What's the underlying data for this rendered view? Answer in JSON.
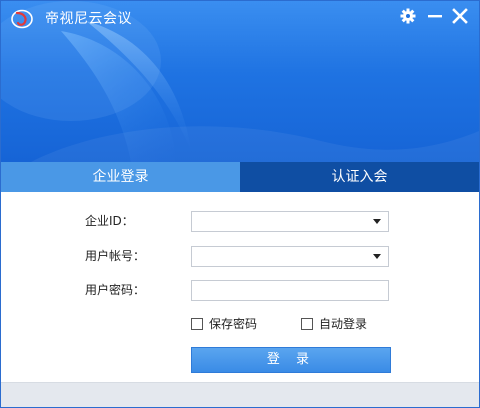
{
  "window": {
    "title": "帝视尼云会议"
  },
  "tabs": [
    {
      "label": "企业登录",
      "active": true
    },
    {
      "label": "认证入会",
      "active": false
    }
  ],
  "form": {
    "enterprise_id_label": "企业ID：",
    "enterprise_id_value": "",
    "account_label": "用户帐号：",
    "account_value": "",
    "password_label": "用户密码：",
    "password_value": "",
    "save_password_label": "保存密码",
    "save_password_checked": false,
    "auto_login_label": "自动登录",
    "auto_login_checked": false,
    "login_button_label": "登 录"
  },
  "colors": {
    "header": "#1f73e2",
    "tab_active": "#4a98e6",
    "tab_inactive": "#0f4ea3",
    "button": "#3a8be6"
  },
  "icons": {
    "logo": "app-logo-icon",
    "settings": "gear-icon",
    "minimize": "minimize-icon",
    "close": "close-icon",
    "dropdown": "chevron-down-icon"
  }
}
